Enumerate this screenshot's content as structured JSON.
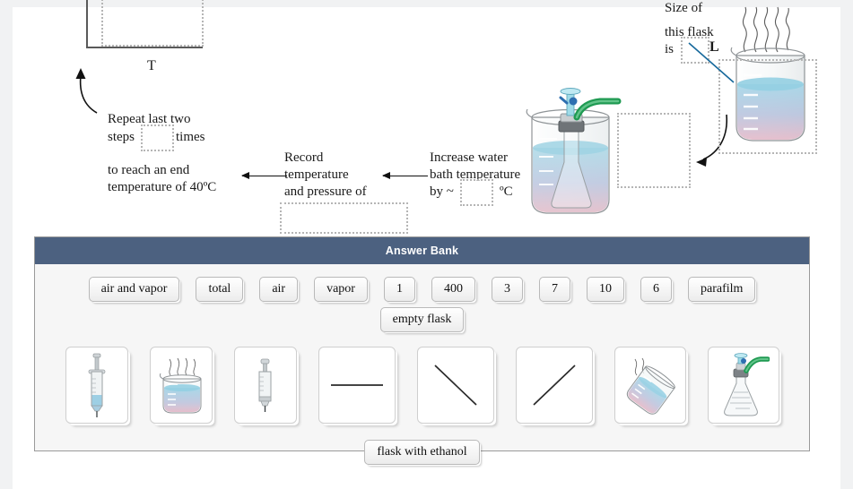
{
  "diagram": {
    "plot": {
      "x_axis_label": "T"
    },
    "steps": [
      {
        "id": "repeat",
        "line1": "Repeat last two",
        "line2_pre": "steps",
        "line2_post": "times",
        "line3": "to reach an end",
        "line4": "temperature of 40ºC"
      },
      {
        "id": "record",
        "line1": "Record",
        "line2": "temperature",
        "line3": "and pressure of"
      },
      {
        "id": "increase",
        "line1": "Increase water",
        "line2": "bath temperature",
        "line3_pre": "by ~",
        "line3_post": "ºC"
      }
    ],
    "flask_note": {
      "line1": "Size of",
      "line2": "this flask",
      "line3_pre": "is",
      "line3_post": "L"
    },
    "icons": {
      "setup_flask": "flask-in-water-bath-icon",
      "beaker": "heated-beaker-icon",
      "curved_arrow_up": "curved-arrow-up-icon",
      "curved_arrow_down": "curved-arrow-down-icon",
      "pointer_line": "callout-pointer-icon"
    },
    "drop_zones": [
      {
        "name": "plot-drop-zone"
      },
      {
        "name": "repeat-count-drop-zone"
      },
      {
        "name": "record-values-drop-zone"
      },
      {
        "name": "temperature-increment-drop-zone"
      },
      {
        "name": "flask-size-drop-zone"
      },
      {
        "name": "setup-drop-zone"
      },
      {
        "name": "beaker-drop-zone"
      },
      {
        "name": "start-drop-zone"
      }
    ]
  },
  "answer_bank": {
    "title": "Answer Bank",
    "chips": [
      {
        "label": "air and vapor"
      },
      {
        "label": "total"
      },
      {
        "label": "air"
      },
      {
        "label": "vapor"
      },
      {
        "label": "1"
      },
      {
        "label": "400"
      },
      {
        "label": "3"
      },
      {
        "label": "7"
      },
      {
        "label": "10"
      },
      {
        "label": "6"
      },
      {
        "label": "parafilm"
      },
      {
        "label": "empty flask"
      }
    ],
    "tiles": [
      {
        "icon": "syringe-filled-icon"
      },
      {
        "icon": "heated-beaker-icon"
      },
      {
        "icon": "syringe-empty-icon"
      },
      {
        "icon": "horizontal-line-icon"
      },
      {
        "icon": "negative-slope-line-icon"
      },
      {
        "icon": "positive-slope-line-icon"
      },
      {
        "icon": "tilted-beaker-icon"
      },
      {
        "icon": "stoppered-flask-icon"
      }
    ],
    "last_chip": {
      "label": "flask with ethanol"
    }
  },
  "colors": {
    "header_bg": "#4c6180",
    "bank_bg": "#f6f6f6",
    "drop_border": "#b5b5b5",
    "page_bg": "#ffffff",
    "chrome_bg": "#f1f2f3"
  }
}
